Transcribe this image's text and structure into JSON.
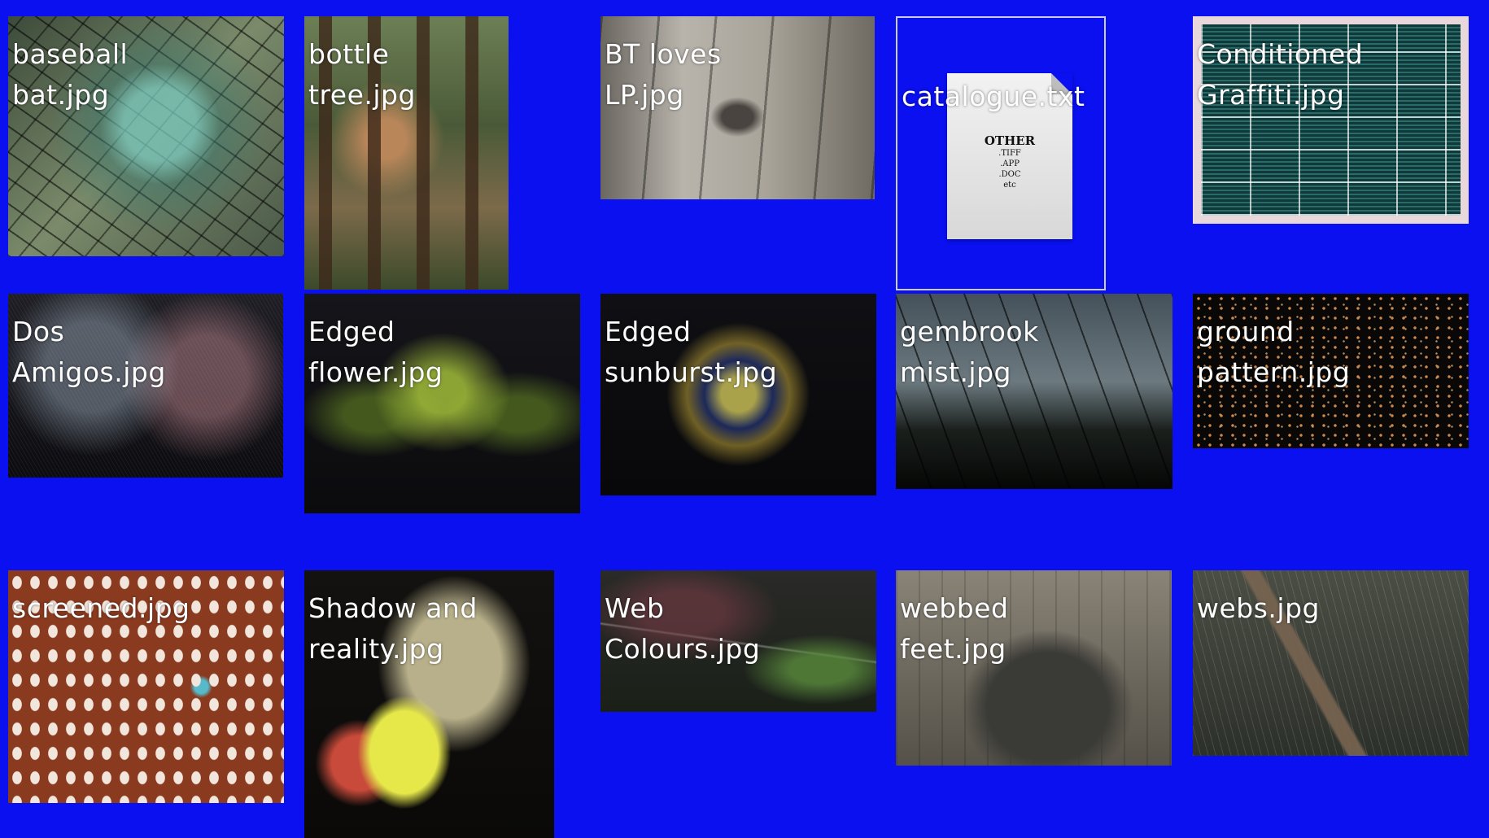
{
  "background_color": "#0a10f0",
  "files": [
    {
      "id": "t1",
      "line1": "baseball",
      "line2": "bat.jpg",
      "kind": "image"
    },
    {
      "id": "t2",
      "line1": "bottle",
      "line2": "tree.jpg",
      "kind": "image"
    },
    {
      "id": "t3",
      "line1": "BT loves",
      "line2": "LP.jpg",
      "kind": "image"
    },
    {
      "id": "t4",
      "line1": "catalogue.txt",
      "line2": "",
      "kind": "text-document",
      "doc_icon": {
        "title": "OTHER",
        "lines": [
          ".TIFF",
          ".APP",
          ".DOC",
          "etc"
        ]
      }
    },
    {
      "id": "t5",
      "line1": "Conditioned",
      "line2": "Graffiti.jpg",
      "kind": "image"
    },
    {
      "id": "t6",
      "line1": "Dos",
      "line2": "Amigos.jpg",
      "kind": "image"
    },
    {
      "id": "t7",
      "line1": "Edged",
      "line2": "flower.jpg",
      "kind": "image"
    },
    {
      "id": "t8",
      "line1": "Edged",
      "line2": "sunburst.jpg",
      "kind": "image"
    },
    {
      "id": "t9",
      "line1": "gembrook",
      "line2": "mist.jpg",
      "kind": "image"
    },
    {
      "id": "t10",
      "line1": "ground",
      "line2": "pattern.jpg",
      "kind": "image"
    },
    {
      "id": "t11",
      "line1": "screened.jpg",
      "line2": "",
      "kind": "image"
    },
    {
      "id": "t12",
      "line1": "Shadow and",
      "line2": "reality.jpg",
      "kind": "image"
    },
    {
      "id": "t13",
      "line1": "Web",
      "line2": "Colours.jpg",
      "kind": "image"
    },
    {
      "id": "t14",
      "line1": "webbed",
      "line2": "feet.jpg",
      "kind": "image"
    },
    {
      "id": "t15",
      "line1": "webs.jpg",
      "line2": "",
      "kind": "image"
    }
  ]
}
